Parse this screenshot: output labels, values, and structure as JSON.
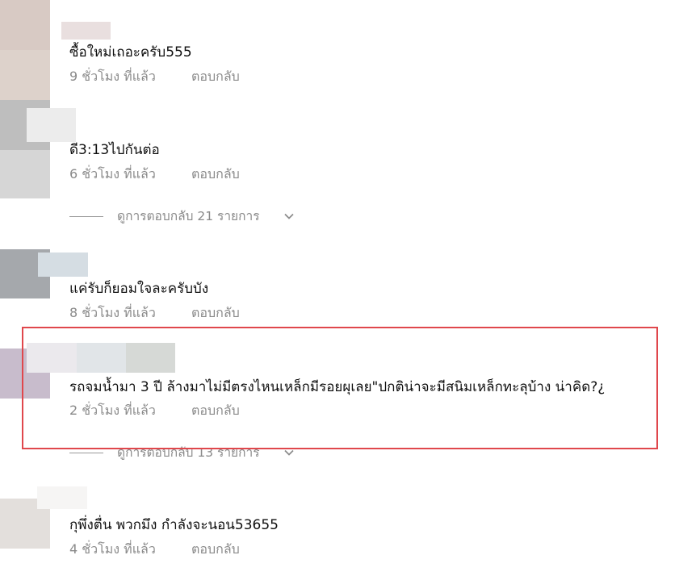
{
  "comments": [
    {
      "text": "ซื้อใหม่เถอะครับ555",
      "time": "9 ชั่วโมง ที่แล้ว",
      "reply_label": "ตอบกลับ",
      "avatar_colors": [
        "#d8cac4",
        "#ddd2cb"
      ],
      "name_color": "#e9dfdf"
    },
    {
      "text": "ดี3:13ไปกันต่อ",
      "time": "6 ชั่วโมง ที่แล้ว",
      "reply_label": "ตอบกลับ",
      "avatar_colors": [
        "#bebebe",
        "#d6d6d6"
      ],
      "name_color": "#ececec",
      "view_replies": "ดูการตอบกลับ 21 รายการ"
    },
    {
      "text": "แค่รับก็ยอมใจละครับบัง",
      "time": "8 ชั่วโมง ที่แล้ว",
      "reply_label": "ตอบกลับ",
      "avatar_colors": [
        "#a5a8ac"
      ],
      "name_color": "#d5dde3"
    },
    {
      "text": "รถจมน้ำมา 3 ปี ล้างมาไม่มีตรงไหนเหล็กมีรอยผุเลย\"ปกติน่าจะมีสนิมเหล็กทะลุบ้าง น่าคิด?¿",
      "time": "2 ชั่วโมง ที่แล้ว",
      "reply_label": "ตอบกลับ",
      "avatar_colors": [
        "#c8bccc"
      ],
      "name_colors": [
        "#ebe9ed",
        "#e1e5e8",
        "#d6d9d6"
      ],
      "view_replies": "ดูการตอบกลับ 13 รายการ"
    },
    {
      "text": "กุพึ่งตื่น พวกมึง กำลังจะนอน53655",
      "time": "4 ชั่วโมง ที่แล้ว",
      "reply_label": "ตอบกลับ",
      "avatar_colors": [
        "#e3dfdc"
      ],
      "name_color": "#f6f5f4"
    }
  ],
  "colors": {
    "highlight": "#e0474c",
    "secondary_text": "#8a8a8a"
  },
  "icons": {
    "expand": "chevron-down-icon"
  }
}
